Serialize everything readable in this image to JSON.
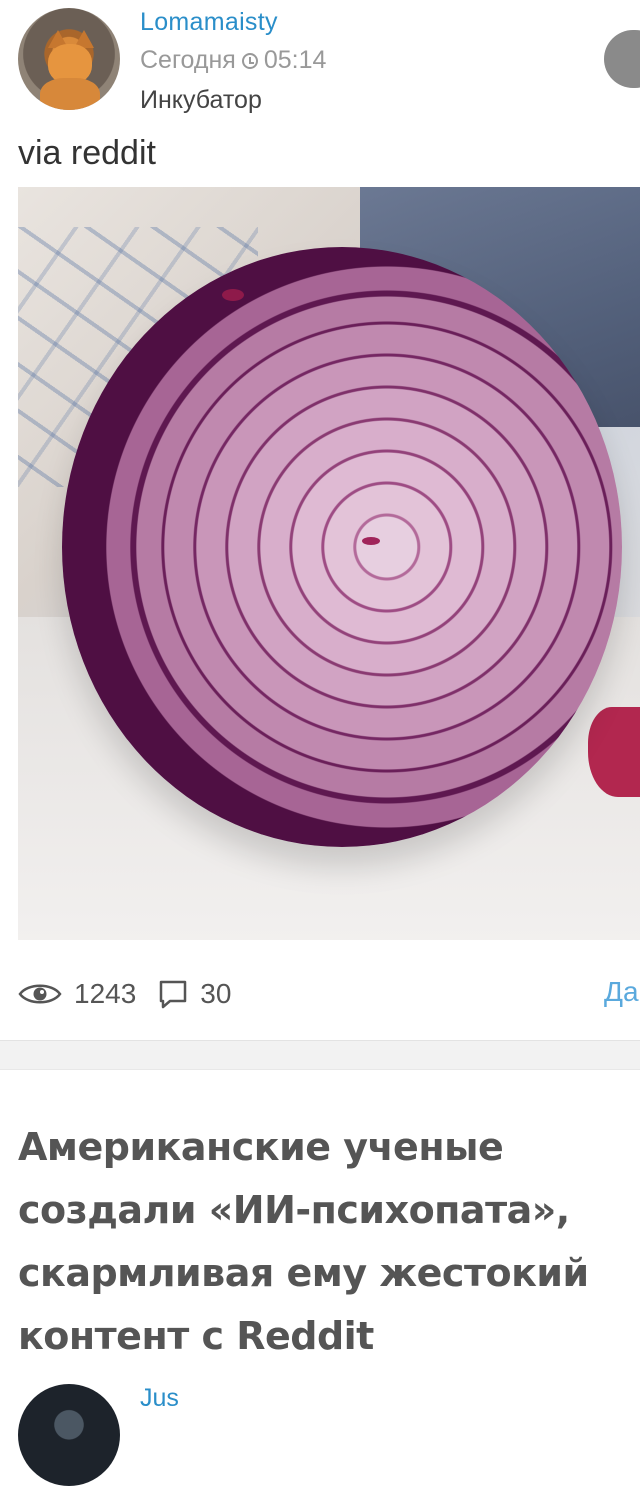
{
  "post": {
    "author": "Lomamaisty",
    "date": "Сегодня",
    "time": "05:14",
    "community": "Инкубатор",
    "text": "via reddit",
    "image": "red onion cross-section",
    "views": "1243",
    "comments": "30",
    "more_link": "Да"
  },
  "next_post": {
    "title": "Американские ученые создали «ИИ-психопата», скармливая ему жестокий контент с Reddit",
    "author": "Jus"
  },
  "colors": {
    "link": "#2a8ec9",
    "meta": "#999999",
    "title": "#555555"
  },
  "icons": [
    "clock-icon",
    "eye-icon",
    "comment-icon"
  ]
}
